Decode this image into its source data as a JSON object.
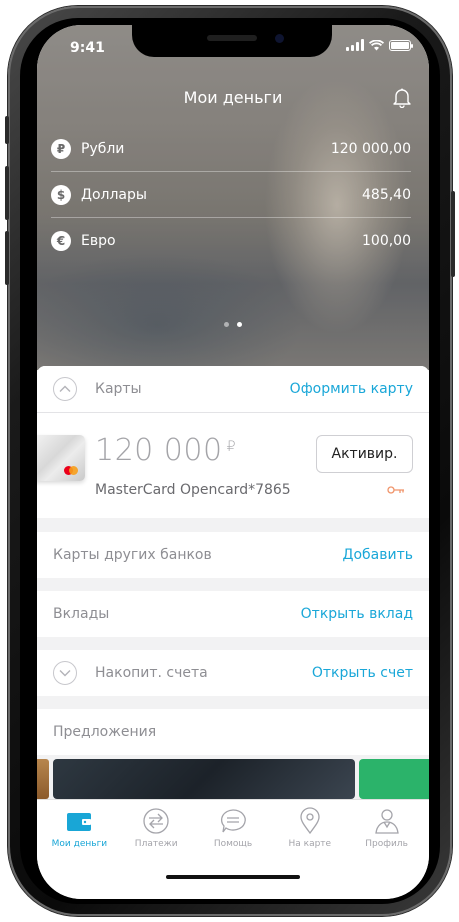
{
  "status": {
    "time": "9:41"
  },
  "header": {
    "title": "Мои деньги"
  },
  "accounts": [
    {
      "symbol": "₽",
      "name": "Рубли",
      "value": "120 000,00"
    },
    {
      "symbol": "$",
      "name": "Доллары",
      "value": "485,40"
    },
    {
      "symbol": "€",
      "name": "Евро",
      "value": "100,00"
    }
  ],
  "pager": {
    "count": 2,
    "active": 1
  },
  "cards_section": {
    "label": "Карты",
    "action": "Оформить карту"
  },
  "card": {
    "amount": "120 000",
    "currency": "₽",
    "name": "MasterCard Opencard",
    "masked": "*7865",
    "button": "Активир."
  },
  "other_banks": {
    "label": "Карты других банков",
    "action": "Добавить"
  },
  "deposits": {
    "label": "Вклады",
    "action": "Открыть вклад"
  },
  "savings": {
    "label": "Накопит. счета",
    "action": "Открыть счет"
  },
  "offers": {
    "label": "Предложения"
  },
  "tabbar": [
    {
      "label": "Мои деньги",
      "icon": "wallet-icon",
      "active": true
    },
    {
      "label": "Платежи",
      "icon": "payments-icon",
      "active": false
    },
    {
      "label": "Помощь",
      "icon": "chat-icon",
      "active": false
    },
    {
      "label": "На карте",
      "icon": "map-pin-icon",
      "active": false
    },
    {
      "label": "Профиль",
      "icon": "profile-icon",
      "active": false
    }
  ],
  "colors": {
    "accent": "#1aa7d8",
    "muted": "#8e8e93",
    "promo_green": "#2bb36a"
  }
}
